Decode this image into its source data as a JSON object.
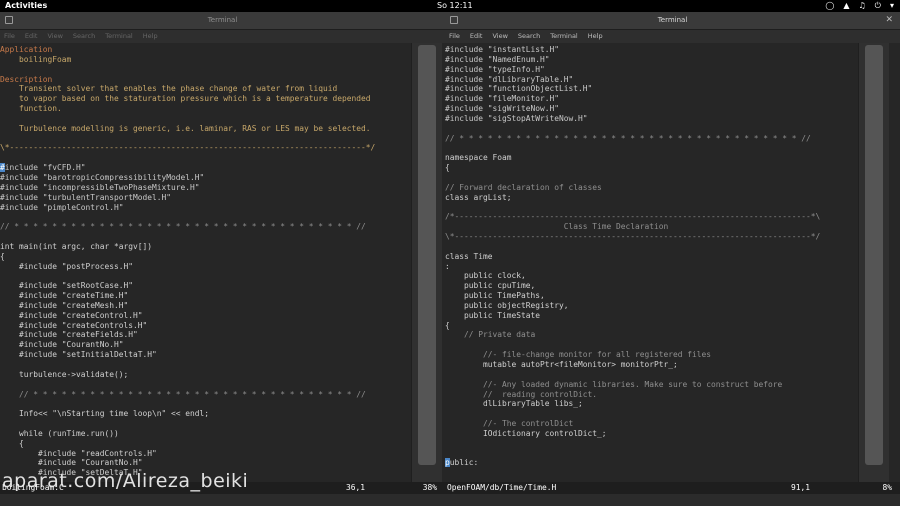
{
  "topbar": {
    "activities": "Activities",
    "clock": "So 12:11"
  },
  "left": {
    "title": "Terminal",
    "menu": [
      "File",
      "Edit",
      "View",
      "Search",
      "Terminal",
      "Help"
    ],
    "lines": [
      {
        "t": "Application",
        "c": "#c87a4a"
      },
      {
        "t": "    boilingFoam",
        "c": "#c8a86a"
      },
      {
        "t": "",
        "c": "#ccc"
      },
      {
        "t": "Description",
        "c": "#c87a4a"
      },
      {
        "t": "    Transient solver that enables the phase change of water from liquid",
        "c": "#c8a86a"
      },
      {
        "t": "    to vapor based on the staturation pressure which is a temperature depended",
        "c": "#c8a86a"
      },
      {
        "t": "    function.",
        "c": "#c8a86a"
      },
      {
        "t": "",
        "c": "#ccc"
      },
      {
        "t": "    Turbulence modelling is generic, i.e. laminar, RAS or LES may be selected.",
        "c": "#c8a86a"
      },
      {
        "t": "",
        "c": "#ccc"
      },
      {
        "t": "\\*---------------------------------------------------------------------------*/",
        "c": "#c8a86a"
      },
      {
        "t": "",
        "c": "#ccc"
      },
      {
        "t": "#include \"fvCFD.H\"",
        "c": "#c8c8c8",
        "cursor": true
      },
      {
        "t": "#include \"barotropicCompressibilityModel.H\"",
        "c": "#c8c8c8"
      },
      {
        "t": "#include \"incompressibleTwoPhaseMixture.H\"",
        "c": "#c8c8c8"
      },
      {
        "t": "#include \"turbulentTransportModel.H\"",
        "c": "#c8c8c8"
      },
      {
        "t": "#include \"pimpleControl.H\"",
        "c": "#c8c8c8"
      },
      {
        "t": "",
        "c": "#ccc"
      },
      {
        "t": "// * * * * * * * * * * * * * * * * * * * * * * * * * * * * * * * * * * * * //",
        "c": "#8f8f8f"
      },
      {
        "t": "",
        "c": "#ccc"
      },
      {
        "t": "int main(int argc, char *argv[])",
        "c": "#d0d0d0"
      },
      {
        "t": "{",
        "c": "#d0d0d0"
      },
      {
        "t": "    #include \"postProcess.H\"",
        "c": "#d0d0d0"
      },
      {
        "t": "",
        "c": "#ccc"
      },
      {
        "t": "    #include \"setRootCase.H\"",
        "c": "#d0d0d0"
      },
      {
        "t": "    #include \"createTime.H\"",
        "c": "#d0d0d0"
      },
      {
        "t": "    #include \"createMesh.H\"",
        "c": "#d0d0d0"
      },
      {
        "t": "    #include \"createControl.H\"",
        "c": "#d0d0d0"
      },
      {
        "t": "    #include \"createControls.H\"",
        "c": "#d0d0d0"
      },
      {
        "t": "    #include \"createFields.H\"",
        "c": "#d0d0d0"
      },
      {
        "t": "    #include \"CourantNo.H\"",
        "c": "#d0d0d0"
      },
      {
        "t": "    #include \"setInitialDeltaT.H\"",
        "c": "#d0d0d0"
      },
      {
        "t": "",
        "c": "#ccc"
      },
      {
        "t": "    turbulence->validate();",
        "c": "#d0d0d0"
      },
      {
        "t": "",
        "c": "#ccc"
      },
      {
        "t": "    // * * * * * * * * * * * * * * * * * * * * * * * * * * * * * * * * * * //",
        "c": "#8f8f8f"
      },
      {
        "t": "",
        "c": "#ccc"
      },
      {
        "t": "    Info<< \"\\nStarting time loop\\n\" << endl;",
        "c": "#d0d0d0"
      },
      {
        "t": "",
        "c": "#ccc"
      },
      {
        "t": "    while (runTime.run())",
        "c": "#d0d0d0"
      },
      {
        "t": "    {",
        "c": "#d0d0d0"
      },
      {
        "t": "        #include \"readControls.H\"",
        "c": "#d0d0d0"
      },
      {
        "t": "        #include \"CourantNo.H\"",
        "c": "#d0d0d0"
      },
      {
        "t": "        #include \"setDeltaT.H\"",
        "c": "#d0d0d0"
      }
    ],
    "status": {
      "file": "boilingFoam.C",
      "pos": "36,1",
      "pct": "38%"
    }
  },
  "right": {
    "title": "Terminal",
    "menu": [
      "File",
      "Edit",
      "View",
      "Search",
      "Terminal",
      "Help"
    ],
    "lines": [
      {
        "t": "#include \"instantList.H\"",
        "c": "#c8c8c8"
      },
      {
        "t": "#include \"NamedEnum.H\"",
        "c": "#c8c8c8"
      },
      {
        "t": "#include \"typeInfo.H\"",
        "c": "#c8c8c8"
      },
      {
        "t": "#include \"dlLibraryTable.H\"",
        "c": "#c8c8c8"
      },
      {
        "t": "#include \"functionObjectList.H\"",
        "c": "#c8c8c8"
      },
      {
        "t": "#include \"fileMonitor.H\"",
        "c": "#c8c8c8"
      },
      {
        "t": "#include \"sigWriteNow.H\"",
        "c": "#c8c8c8"
      },
      {
        "t": "#include \"sigStopAtWriteNow.H\"",
        "c": "#c8c8c8"
      },
      {
        "t": "",
        "c": "#ccc"
      },
      {
        "t": "// * * * * * * * * * * * * * * * * * * * * * * * * * * * * * * * * * * * * //",
        "c": "#8f8f8f"
      },
      {
        "t": "",
        "c": "#ccc"
      },
      {
        "t": "namespace Foam",
        "c": "#d0d0d0"
      },
      {
        "t": "{",
        "c": "#d0d0d0"
      },
      {
        "t": "",
        "c": "#ccc"
      },
      {
        "t": "// Forward declaration of classes",
        "c": "#8f8f8f"
      },
      {
        "t": "class argList;",
        "c": "#d0d0d0"
      },
      {
        "t": "",
        "c": "#ccc"
      },
      {
        "t": "/*---------------------------------------------------------------------------*\\",
        "c": "#8f8f8f"
      },
      {
        "t": "                         Class Time Declaration",
        "c": "#8f8f8f"
      },
      {
        "t": "\\*---------------------------------------------------------------------------*/",
        "c": "#8f8f8f"
      },
      {
        "t": "",
        "c": "#ccc"
      },
      {
        "t": "class Time",
        "c": "#d0d0d0"
      },
      {
        "t": ":",
        "c": "#d0d0d0"
      },
      {
        "t": "    public clock,",
        "c": "#d0d0d0"
      },
      {
        "t": "    public cpuTime,",
        "c": "#d0d0d0"
      },
      {
        "t": "    public TimePaths,",
        "c": "#d0d0d0"
      },
      {
        "t": "    public objectRegistry,",
        "c": "#d0d0d0"
      },
      {
        "t": "    public TimeState",
        "c": "#d0d0d0"
      },
      {
        "t": "{",
        "c": "#d0d0d0"
      },
      {
        "t": "    // Private data",
        "c": "#8f8f8f"
      },
      {
        "t": "",
        "c": "#ccc"
      },
      {
        "t": "        //- file-change monitor for all registered files",
        "c": "#8f8f8f"
      },
      {
        "t": "        mutable autoPtr<fileMonitor> monitorPtr_;",
        "c": "#d0d0d0"
      },
      {
        "t": "",
        "c": "#ccc"
      },
      {
        "t": "        //- Any loaded dynamic libraries. Make sure to construct before",
        "c": "#8f8f8f"
      },
      {
        "t": "        //  reading controlDict.",
        "c": "#8f8f8f"
      },
      {
        "t": "        dlLibraryTable libs_;",
        "c": "#d0d0d0"
      },
      {
        "t": "",
        "c": "#ccc"
      },
      {
        "t": "        //- The controlDict",
        "c": "#8f8f8f"
      },
      {
        "t": "        IOdictionary controlDict_;",
        "c": "#d0d0d0"
      },
      {
        "t": "",
        "c": "#ccc"
      },
      {
        "t": "",
        "c": "#ccc"
      },
      {
        "t": "public:",
        "c": "#d0d0d0",
        "cursor": true
      }
    ],
    "status": {
      "file": "OpenFOAM/db/Time/Time.H",
      "pos": "91,1",
      "pct": "8%"
    }
  },
  "watermark": "aparat.com/Alireza_beiki"
}
